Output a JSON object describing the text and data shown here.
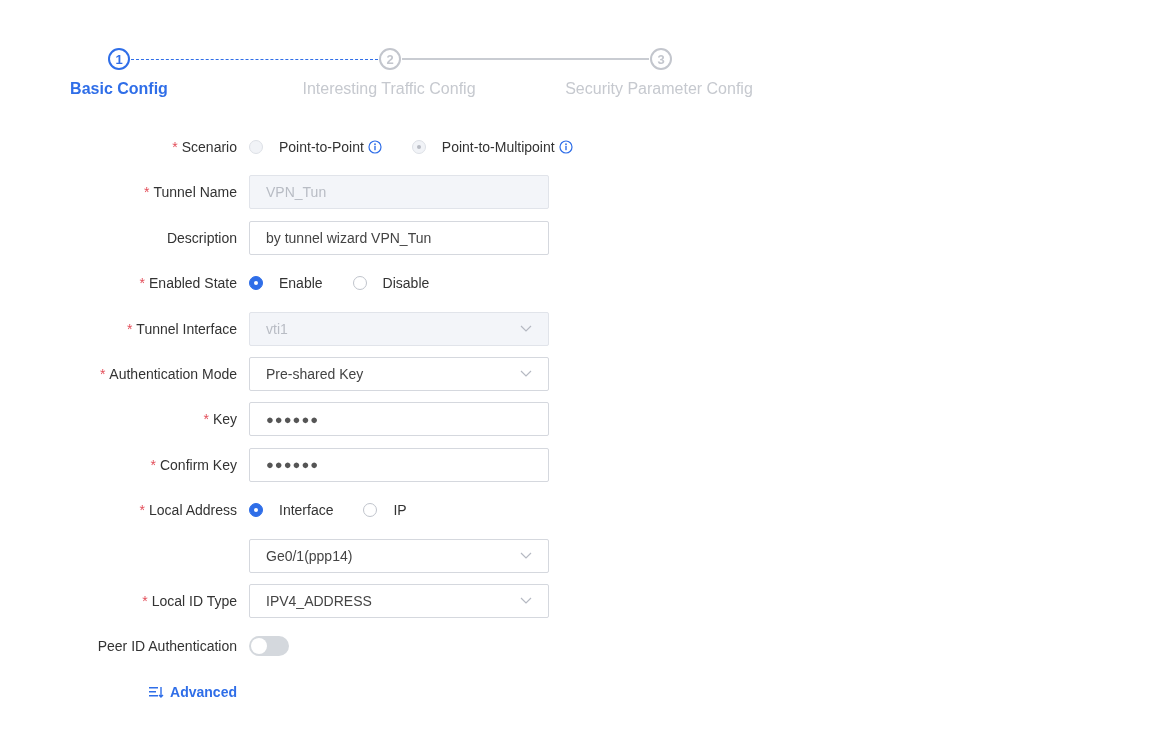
{
  "steps": [
    {
      "number": "1",
      "label": "Basic Config",
      "selected": true
    },
    {
      "number": "2",
      "label": "Interesting Traffic Config",
      "selected": false
    },
    {
      "number": "3",
      "label": "Security Parameter Config",
      "selected": false
    }
  ],
  "fields": [
    {
      "kind": "radio",
      "label": "Scenario",
      "required_mark": "*",
      "disabled": true,
      "options": [
        {
          "label": "Point-to-Point",
          "selected": false,
          "info": true
        },
        {
          "label": "Point-to-Multipoint",
          "selected": true,
          "info": true
        }
      ]
    },
    {
      "kind": "input",
      "label": "Tunnel Name",
      "required_mark": "*",
      "disabled": true,
      "value": "VPN_Tun"
    },
    {
      "kind": "input",
      "label": "Description",
      "disabled": false,
      "value": "by tunnel wizard VPN_Tun"
    },
    {
      "kind": "radio",
      "label": "Enabled State",
      "required_mark": "*",
      "disabled": false,
      "options": [
        {
          "label": "Enable",
          "selected": true
        },
        {
          "label": "Disable",
          "selected": false
        }
      ]
    },
    {
      "kind": "select",
      "label": "Tunnel Interface",
      "required_mark": "*",
      "disabled": true,
      "value": "vti1"
    },
    {
      "kind": "select",
      "label": "Authentication Mode",
      "required_mark": "*",
      "disabled": false,
      "value": "Pre-shared Key"
    },
    {
      "kind": "password",
      "label": "Key",
      "required_mark": "*",
      "disabled": false,
      "value": "●●●●●●"
    },
    {
      "kind": "password",
      "label": "Confirm Key",
      "required_mark": "*",
      "disabled": false,
      "value": "●●●●●●"
    },
    {
      "kind": "radio",
      "label": "Local Address",
      "required_mark": "*",
      "disabled": false,
      "options": [
        {
          "label": "Interface",
          "selected": true
        },
        {
          "label": "IP",
          "selected": false
        }
      ]
    },
    {
      "kind": "select",
      "disabled": false,
      "value": "Ge0/1(ppp14)"
    },
    {
      "kind": "select",
      "label": "Local ID Type",
      "required_mark": "*",
      "disabled": false,
      "value": "IPV4_ADDRESS"
    },
    {
      "kind": "switch",
      "label": "Peer ID Authentication",
      "on": false
    }
  ],
  "advanced_link": {
    "label": "Advanced"
  }
}
